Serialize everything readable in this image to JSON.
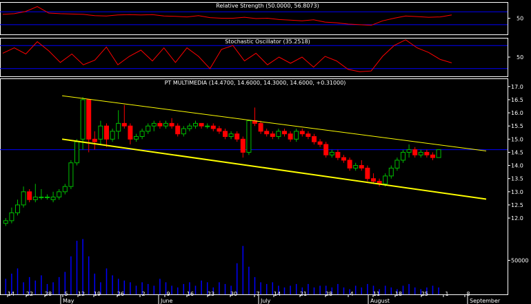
{
  "chart_data": [
    {
      "type": "line",
      "name": "rsi-panel",
      "title": "Relative Strength (50.0000, 56.8073)",
      "ylim": [
        0,
        100
      ],
      "levels": [
        30,
        70
      ],
      "yticks": [
        50
      ],
      "series": [
        {
          "color": "#ff0000",
          "x": [
            0,
            4,
            8,
            12,
            16,
            20,
            24,
            28,
            32,
            36,
            40,
            44,
            48,
            52,
            56,
            60,
            64,
            68,
            72,
            76,
            80,
            84,
            88,
            92,
            96,
            100,
            104,
            108,
            112,
            116,
            120,
            124,
            128,
            132,
            136,
            140,
            144,
            148,
            152,
            156
          ],
          "values": [
            62,
            64,
            71,
            86,
            66,
            64,
            63,
            62,
            58,
            57,
            60,
            61,
            60,
            61,
            57,
            56,
            54,
            58,
            52,
            50,
            50,
            53,
            49,
            50,
            46,
            44,
            42,
            45,
            38,
            36,
            32,
            30,
            28,
            42,
            50,
            57,
            55,
            53,
            54,
            60
          ]
        }
      ]
    },
    {
      "type": "line",
      "name": "stochastic-panel",
      "title": "Stochastic Oscillator (35.2518)",
      "ylim": [
        0,
        100
      ],
      "levels": [
        20,
        80
      ],
      "yticks": [
        50
      ],
      "series": [
        {
          "color": "#ff0000",
          "x": [
            0,
            4,
            8,
            12,
            16,
            20,
            24,
            28,
            32,
            36,
            40,
            44,
            48,
            52,
            56,
            60,
            64,
            68,
            72,
            76,
            80,
            84,
            88,
            92,
            96,
            100,
            104,
            108,
            112,
            116,
            120,
            124,
            128,
            132,
            136,
            140,
            144,
            148,
            152,
            156
          ],
          "values": [
            60,
            74,
            58,
            90,
            66,
            36,
            58,
            30,
            42,
            76,
            30,
            52,
            68,
            40,
            74,
            36,
            74,
            52,
            20,
            70,
            80,
            40,
            60,
            30,
            50,
            34,
            50,
            24,
            52,
            40,
            18,
            12,
            14,
            52,
            80,
            95,
            74,
            62,
            44,
            35
          ]
        }
      ]
    },
    {
      "type": "candlestick",
      "name": "price-panel",
      "title": "PT MULTIMEDIA (14.4700, 14.6000, 14.3000, 14.6000, +0.31000)",
      "ylim": [
        11.4,
        17.1
      ],
      "yticks": [
        "17.0",
        "16.5",
        "16.0",
        "15.5",
        "15.0",
        "14.5",
        "14.0",
        "13.5",
        "13.0",
        "12.5",
        "12.0"
      ],
      "volume_ticks": [
        "50000"
      ],
      "x_ticks": [
        "14",
        "22",
        "28",
        "5",
        "12",
        "19",
        "26",
        "2",
        "9",
        "16",
        "23",
        "30",
        "7",
        "14",
        "21",
        "28",
        "4",
        "11",
        "18",
        "25",
        "1",
        "8"
      ],
      "month_labels": [
        "May",
        "June",
        "July",
        "August",
        "September"
      ],
      "reference_level": 14.6,
      "reference_color": "#0000ff",
      "trendlines": [
        {
          "color": "#ffff00",
          "from": [
            21,
            16.65
          ],
          "to": [
            171,
            14.55
          ]
        },
        {
          "color": "#ffff00",
          "from": [
            21,
            15.0
          ],
          "to": [
            171,
            12.72
          ]
        }
      ],
      "ohlc": [
        [
          11.8,
          12.0,
          11.7,
          11.9
        ],
        [
          11.9,
          12.4,
          11.8,
          12.2
        ],
        [
          12.2,
          12.7,
          12.1,
          12.5
        ],
        [
          12.5,
          13.2,
          12.4,
          13.0
        ],
        [
          13.0,
          13.1,
          12.6,
          12.7
        ],
        [
          12.7,
          13.3,
          12.6,
          12.8
        ],
        [
          12.8,
          13.1,
          12.7,
          12.8
        ],
        [
          12.8,
          12.9,
          12.7,
          12.8
        ],
        [
          12.7,
          13.0,
          12.6,
          12.8
        ],
        [
          12.8,
          13.1,
          12.7,
          13.0
        ],
        [
          13.0,
          13.3,
          12.9,
          13.2
        ],
        [
          13.2,
          14.2,
          13.1,
          14.1
        ],
        [
          14.1,
          15.0,
          14.0,
          14.9
        ],
        [
          15.0,
          16.6,
          14.6,
          16.5
        ],
        [
          16.5,
          16.5,
          14.5,
          15.0
        ],
        [
          15.0,
          15.3,
          14.6,
          14.9
        ],
        [
          15.0,
          15.7,
          14.8,
          15.5
        ],
        [
          15.5,
          15.6,
          14.7,
          15.0
        ],
        [
          15.0,
          15.4,
          14.9,
          15.3
        ],
        [
          15.3,
          16.1,
          15.0,
          15.6
        ],
        [
          15.6,
          16.3,
          15.4,
          15.5
        ],
        [
          15.5,
          15.6,
          14.8,
          15.0
        ],
        [
          15.0,
          15.2,
          14.9,
          15.1
        ],
        [
          15.1,
          15.4,
          15.0,
          15.3
        ],
        [
          15.3,
          15.6,
          15.2,
          15.5
        ],
        [
          15.5,
          15.7,
          15.3,
          15.6
        ],
        [
          15.6,
          15.7,
          15.4,
          15.5
        ],
        [
          15.5,
          15.7,
          15.4,
          15.6
        ],
        [
          15.6,
          15.8,
          15.4,
          15.5
        ],
        [
          15.5,
          15.6,
          15.1,
          15.2
        ],
        [
          15.2,
          15.5,
          15.1,
          15.4
        ],
        [
          15.4,
          15.6,
          15.3,
          15.5
        ],
        [
          15.5,
          15.7,
          15.4,
          15.6
        ],
        [
          15.6,
          15.6,
          15.4,
          15.5
        ],
        [
          15.5,
          15.6,
          15.4,
          15.5
        ],
        [
          15.5,
          15.6,
          15.3,
          15.4
        ],
        [
          15.4,
          15.5,
          15.2,
          15.3
        ],
        [
          15.3,
          15.4,
          15.0,
          15.1
        ],
        [
          15.1,
          15.3,
          15.0,
          15.2
        ],
        [
          15.2,
          15.3,
          14.9,
          15.0
        ],
        [
          15.0,
          15.1,
          14.3,
          14.5
        ],
        [
          14.5,
          15.7,
          14.4,
          15.7
        ],
        [
          15.7,
          16.2,
          15.5,
          15.6
        ],
        [
          15.6,
          15.7,
          15.2,
          15.3
        ],
        [
          15.3,
          15.4,
          15.1,
          15.2
        ],
        [
          15.2,
          15.3,
          15.0,
          15.1
        ],
        [
          15.1,
          15.4,
          15.0,
          15.3
        ],
        [
          15.3,
          15.4,
          15.1,
          15.2
        ],
        [
          15.2,
          15.3,
          14.9,
          15.0
        ],
        [
          15.0,
          15.4,
          14.9,
          15.3
        ],
        [
          15.3,
          15.4,
          15.1,
          15.2
        ],
        [
          15.2,
          15.3,
          15.0,
          15.1
        ],
        [
          15.1,
          15.2,
          14.8,
          14.9
        ],
        [
          14.9,
          15.0,
          14.7,
          14.8
        ],
        [
          14.8,
          14.9,
          14.3,
          14.4
        ],
        [
          14.4,
          14.6,
          14.3,
          14.5
        ],
        [
          14.5,
          14.6,
          14.2,
          14.3
        ],
        [
          14.3,
          14.4,
          14.1,
          14.2
        ],
        [
          14.2,
          14.3,
          13.8,
          13.9
        ],
        [
          13.9,
          14.1,
          13.8,
          14.0
        ],
        [
          14.0,
          14.2,
          13.8,
          13.9
        ],
        [
          13.9,
          14.0,
          13.4,
          13.5
        ],
        [
          13.5,
          13.7,
          13.3,
          13.4
        ],
        [
          13.4,
          13.5,
          13.2,
          13.3
        ],
        [
          13.3,
          13.7,
          13.2,
          13.6
        ],
        [
          13.6,
          14.0,
          13.5,
          13.9
        ],
        [
          13.9,
          14.3,
          13.8,
          14.2
        ],
        [
          14.2,
          14.6,
          14.1,
          14.5
        ],
        [
          14.5,
          14.8,
          14.3,
          14.6
        ],
        [
          14.6,
          14.7,
          14.3,
          14.4
        ],
        [
          14.4,
          14.6,
          14.3,
          14.5
        ],
        [
          14.5,
          14.6,
          14.3,
          14.4
        ],
        [
          14.4,
          14.5,
          14.2,
          14.3
        ],
        [
          14.3,
          14.6,
          14.3,
          14.6
        ]
      ],
      "volume": [
        18,
        24,
        30,
        14,
        20,
        16,
        22,
        12,
        14,
        20,
        26,
        44,
        62,
        64,
        44,
        24,
        14,
        30,
        22,
        18,
        16,
        14,
        10,
        14,
        12,
        10,
        18,
        14,
        10,
        8,
        12,
        14,
        10,
        16,
        14,
        8,
        14,
        12,
        10,
        36,
        56,
        32,
        20,
        14,
        12,
        14,
        10,
        8,
        10,
        12,
        8,
        12,
        8,
        10,
        10,
        8,
        12,
        8,
        6,
        10,
        8,
        12,
        10,
        6,
        10,
        8,
        6,
        10,
        12,
        8,
        6,
        8,
        10,
        8
      ]
    }
  ]
}
